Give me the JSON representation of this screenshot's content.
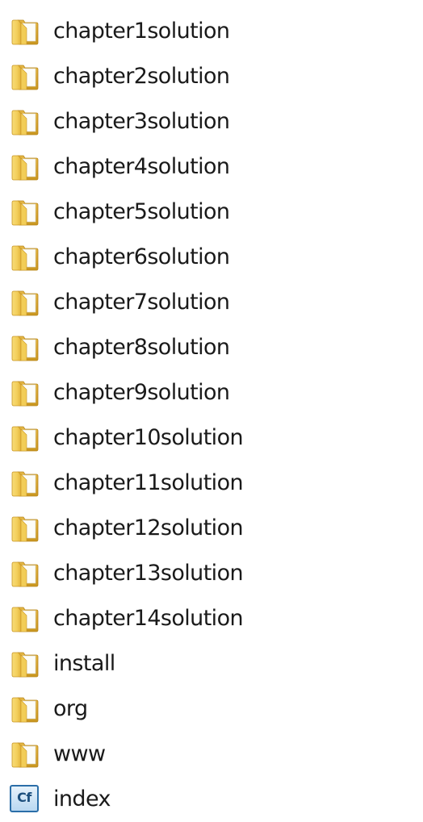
{
  "items": [
    {
      "name": "chapter1solution",
      "icon": "folder-icon"
    },
    {
      "name": "chapter2solution",
      "icon": "folder-icon"
    },
    {
      "name": "chapter3solution",
      "icon": "folder-icon"
    },
    {
      "name": "chapter4solution",
      "icon": "folder-icon"
    },
    {
      "name": "chapter5solution",
      "icon": "folder-icon"
    },
    {
      "name": "chapter6solution",
      "icon": "folder-icon"
    },
    {
      "name": "chapter7solution",
      "icon": "folder-icon"
    },
    {
      "name": "chapter8solution",
      "icon": "folder-icon"
    },
    {
      "name": "chapter9solution",
      "icon": "folder-icon"
    },
    {
      "name": "chapter10solution",
      "icon": "folder-icon"
    },
    {
      "name": "chapter11solution",
      "icon": "folder-icon"
    },
    {
      "name": "chapter12solution",
      "icon": "folder-icon"
    },
    {
      "name": "chapter13solution",
      "icon": "folder-icon"
    },
    {
      "name": "chapter14solution",
      "icon": "folder-icon"
    },
    {
      "name": "install",
      "icon": "folder-icon"
    },
    {
      "name": "org",
      "icon": "folder-icon"
    },
    {
      "name": "www",
      "icon": "folder-icon"
    },
    {
      "name": "index",
      "icon": "coldfusion-file-icon",
      "icon_text": "Cf"
    }
  ],
  "colors": {
    "folder_front": "#f5d56a",
    "folder_back": "#d9a92f",
    "folder_edge": "#c99523",
    "text": "#1a1a1a"
  }
}
